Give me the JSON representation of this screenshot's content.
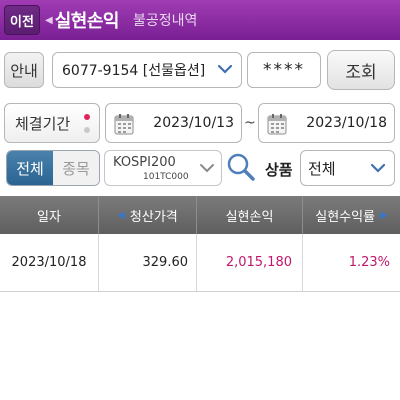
{
  "header": {
    "back_label": "이전",
    "title": "실현손익",
    "subtitle": "불공정내역"
  },
  "row1": {
    "guide_label": "안내",
    "account_value": "6077-9154 [선물옵션]",
    "password_mask": "****",
    "query_label": "조회"
  },
  "row2": {
    "period_label": "체결기간",
    "start_date": "2023/10/13",
    "separator": "~",
    "end_date": "2023/10/18"
  },
  "row3": {
    "seg_all": "전체",
    "seg_item": "종목",
    "kospi_main": "KOSPI200",
    "kospi_code": "101TC000",
    "product_label": "상품",
    "product_value": "전체"
  },
  "table": {
    "headers": [
      "일자",
      "청산가격",
      "실현손익",
      "실현수익률"
    ],
    "rows": [
      [
        "2023/10/18",
        "329.60",
        "2,015,180",
        "1.23%"
      ]
    ]
  },
  "colors": {
    "header_purple": "#8b2aa3",
    "profit_red": "#c0176b",
    "segment_blue": "#2b6392"
  },
  "icons": [
    "chevron-down-icon",
    "calendar-icon",
    "search-icon",
    "left-arrow-icon",
    "right-arrow-icon"
  ]
}
